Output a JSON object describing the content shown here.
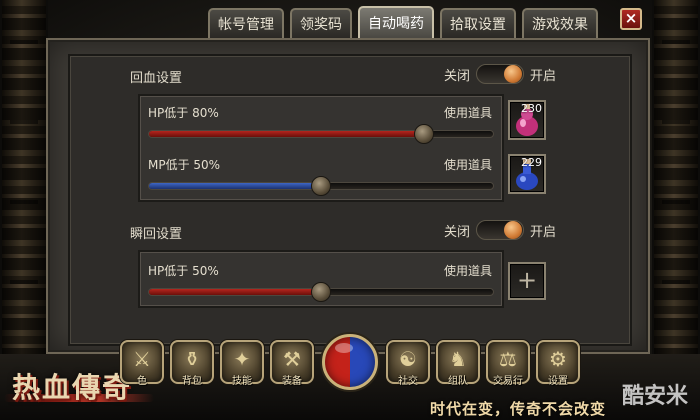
{
  "tabs": [
    {
      "label": "帐号管理",
      "active": false
    },
    {
      "label": "领奖码",
      "active": false
    },
    {
      "label": "自动喝药",
      "active": true
    },
    {
      "label": "拾取设置",
      "active": false
    },
    {
      "label": "游戏效果",
      "active": false
    }
  ],
  "close_icon": "×",
  "heal_section": {
    "title": "回血设置",
    "toggle_off": "关闭",
    "toggle_on": "开启",
    "enabled": true,
    "rows": [
      {
        "label": "HP低于 80%",
        "use_label": "使用道具",
        "percent": 80,
        "bar_color": "red",
        "item_count": "230",
        "item_icon": "red-potion-icon"
      },
      {
        "label": "MP低于 50%",
        "use_label": "使用道具",
        "percent": 50,
        "bar_color": "blue",
        "item_count": "229",
        "item_icon": "blue-potion-icon"
      }
    ]
  },
  "instant_section": {
    "title": "瞬回设置",
    "toggle_off": "关闭",
    "toggle_on": "开启",
    "enabled": true,
    "row": {
      "label": "HP低于 50%",
      "use_label": "使用道具",
      "percent": 50,
      "bar_color": "red",
      "slot_symbol": "+"
    }
  },
  "toolbar": [
    {
      "label": "色",
      "icon": "character-icon",
      "glyph": "⚔"
    },
    {
      "label": "背包",
      "icon": "bag-icon",
      "glyph": "⚱"
    },
    {
      "label": "技能",
      "icon": "skill-book-icon",
      "glyph": "✦"
    },
    {
      "label": "装备",
      "icon": "equipment-icon",
      "glyph": "⚒"
    },
    {
      "label": "社交",
      "icon": "social-icon",
      "glyph": "☯"
    },
    {
      "label": "组队",
      "icon": "team-icon",
      "glyph": "♞"
    },
    {
      "label": "交易行",
      "icon": "trade-hammer-icon",
      "glyph": "⚖"
    },
    {
      "label": "设置",
      "icon": "settings-gear-icon",
      "glyph": "⚙"
    }
  ],
  "logo_text": "热血傳奇",
  "tagline": "时代在变，传奇不会改变",
  "watermark": "酷安米",
  "colors": {
    "accent_orange": "#d07a34",
    "hp_red": "#b4261e",
    "mp_blue": "#3e66c4",
    "close_red": "#b02a22"
  }
}
